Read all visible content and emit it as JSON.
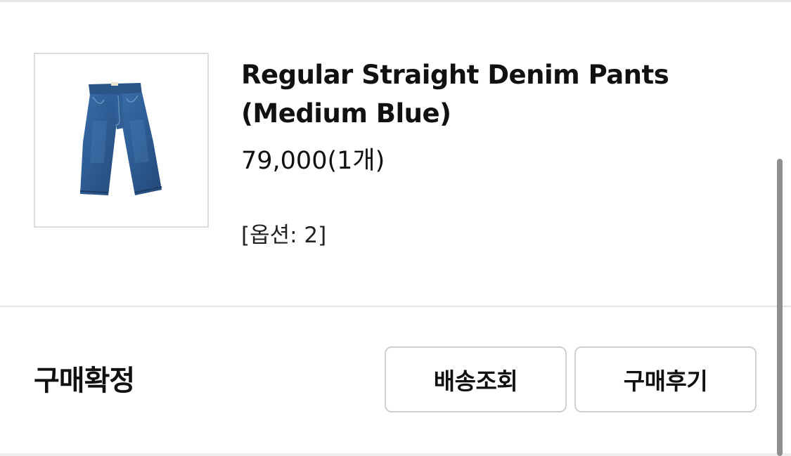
{
  "product": {
    "name": "Regular Straight Denim Pants (Medium Blue)",
    "price": "79,000(1개)",
    "option": "[옵션: 2]",
    "image_icon": "denim-pants-image"
  },
  "order": {
    "status": "구매확정",
    "track_label": "배송조회",
    "review_label": "구매후기"
  },
  "colors": {
    "denim": "#2f5f96",
    "border": "#dcdcdc",
    "text": "#111111"
  }
}
